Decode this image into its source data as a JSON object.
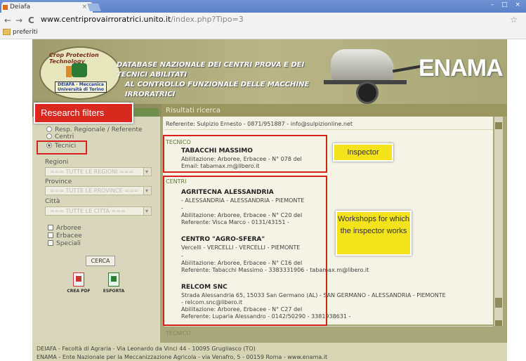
{
  "browser": {
    "tab_title": "Deiafa",
    "tab_close": "×",
    "back": "←",
    "forward": "→",
    "reload": "C",
    "url_host": "www.centriprovairroratrici.unito.it",
    "url_path": "/index.php?Tipo=3",
    "bookmark": "preferiti",
    "star": "☆"
  },
  "header": {
    "logo_arc": "Crop Protection Technology",
    "logo_band_1": "DEIAFA - Meccanica",
    "logo_band_2": "Università di Torino",
    "title_1": "DATABASE NAZIONALE DEI CENTRI PROVA E DEI TECNICI ABILITATI",
    "title_2": "AL CONTROLLO FUNZIONALE DELLE MACCHINE IRRORATRICI",
    "brand": "ENAMA"
  },
  "filters": {
    "banner": "Research filters",
    "radio_1": "Resp. Regionale / Referente",
    "radio_2": "Centri",
    "radio_3": "Tecnici",
    "regioni_label": "Regioni",
    "regioni_value": "=== TUTTE LE REGIONI ===",
    "province_label": "Province",
    "province_value": "=== TUTTE LE PROVINCE ===",
    "citta_label": "Città",
    "citta_value": "=== TUTTE LE CITTÀ ===",
    "chk_1": "Arboree",
    "chk_2": "Erbacee",
    "chk_3": "Speciali",
    "search": "CERCA",
    "pdf": "CREA PDF",
    "export": "ESPORTA"
  },
  "results": {
    "heading": "Risultati ricerca",
    "top_line": "Referente: Sulpizio Ernesto - 0871/951887 - info@sulpizionline.net",
    "tecnico_heading": "TECNICO",
    "tecnico": {
      "name": "TABACCHI MASSIMO",
      "line1": "Abilitazione: Arboree, Erbacee  - N° 078 del",
      "line2": "Email: tabamax.m@libero.it"
    },
    "centri_heading": "CENTRI",
    "centri": [
      {
        "name": "AGRITECNA ALESSANDRIA",
        "line1": "- ALESSANDRIA - ALESSANDRIA - PIEMONTE",
        "line2": "-",
        "line3": "Abilitazione: Arboree, Erbacee - N° C20 del",
        "line4": "Referente: Visca Marco - 0131/43151 -"
      },
      {
        "name": "CENTRO \"AGRO-SFERA\"",
        "line1": "Vercelli - VERCELLI - VERCELLI - PIEMONTE",
        "line2": "-",
        "line3": "Abilitazione: Arboree, Erbacee - N° C16 del",
        "line4": "Referente: Tabacchi Massimo - 3383331906 - tabamax.m@libero.it"
      },
      {
        "name": "RELCOM SNC",
        "line1": "Strada Alessandria 65, 15033 San Germano (AL) - SAN GERMANO - ALESSANDRIA - PIEMONTE",
        "line2": "- relcom.snc@libero.it",
        "line3": "Abilitazione: Arboree, Erbacee - N° C27 del",
        "line4": "Referente: Luparia Alessandro - 0142/50290 - 3381938631 -"
      }
    ],
    "next_heading": "TECNICO"
  },
  "callouts": {
    "inspector": "Inspector",
    "workshops": "Workshops for which the inspector works"
  },
  "footer": {
    "line1": "DEIAFA - Facoltà di Agraria - Via Leonardo da Vinci 44 - 10095 Grugliasco (TO)",
    "line2": "ENAMA - Ente Nazionale per la Meccanizzazione Agricola - via Venafro, 5 - 00159 Roma - www.enama.it"
  }
}
